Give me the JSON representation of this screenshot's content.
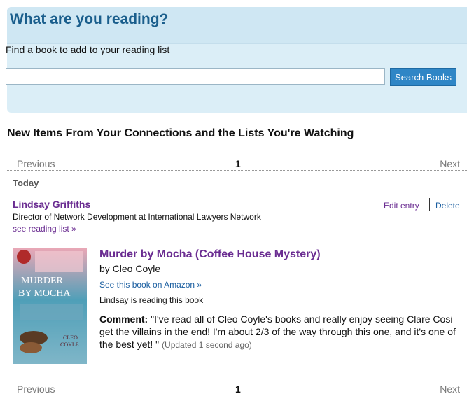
{
  "search": {
    "title": "What are you reading?",
    "prompt": "Find a book to add to your reading list",
    "input_value": "",
    "button_label": "Search Books"
  },
  "feed": {
    "heading": "New Items From Your Connections and the Lists You're Watching",
    "pager": {
      "previous": "Previous",
      "page": "1",
      "next": "Next"
    },
    "day": "Today",
    "entry": {
      "user_name": "Lindsay Griffiths",
      "user_title": "Director of Network Development at International Lawyers Network",
      "see_list": "see reading list »",
      "edit_label": "Edit entry",
      "delete_label": "Delete",
      "book": {
        "title": "Murder by Mocha (Coffee House Mystery)",
        "author": "by Cleo Coyle",
        "amazon_link": "See this book on Amazon »",
        "status": "Lindsay is reading this book",
        "comment_label": "Comment:",
        "comment_text": "\"I've read all of Cleo Coyle's books and really enjoy seeing Clare Cosi get the villains in the end! I'm about 2/3 of the way through this one, and it's one of the best yet! \"",
        "updated": "(Updated 1 second ago)",
        "cover_text": {
          "title_line1": "MURDER",
          "title_line2": "BY MOCHA",
          "author_line1": "CLEO",
          "author_line2": "COYLE"
        }
      }
    }
  },
  "colors": {
    "panel_bg": "#dbeef7",
    "heading_blue": "#1a5e8c",
    "link_purple": "#6a2c91",
    "link_blue": "#1a5ea0",
    "button_blue": "#2f86c6"
  }
}
